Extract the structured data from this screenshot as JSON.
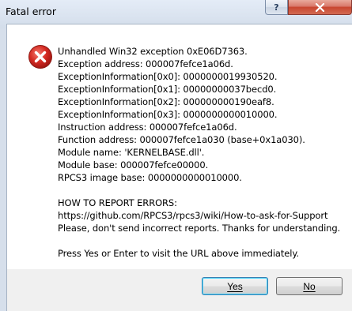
{
  "window": {
    "title": "Fatal error",
    "help_label": "?",
    "close_icon": "close-icon"
  },
  "dialog": {
    "icon": "error-icon",
    "lines": [
      "Unhandled Win32 exception 0xE06D7363.",
      "Exception address: 000007fefce1a06d.",
      "ExceptionInformation[0x0]: 0000000019930520.",
      "ExceptionInformation[0x1]: 00000000037becd0.",
      "ExceptionInformation[0x2]: 000000000190eaf8.",
      "ExceptionInformation[0x3]: 0000000000010000.",
      "Instruction address: 000007fefce1a06d.",
      "Function address: 000007fefce1a030 (base+0x1a030).",
      "Module name: 'KERNELBASE.dll'.",
      "Module base: 000007fefce00000.",
      "RPCS3 image base: 0000000000010000.",
      "",
      "HOW TO REPORT ERRORS:",
      "https://github.com/RPCS3/rpcs3/wiki/How-to-ask-for-Support",
      "Please, don't send incorrect reports. Thanks for understanding.",
      "",
      "Press Yes or Enter to visit the URL above immediately."
    ]
  },
  "buttons": {
    "yes": "Yes",
    "no": "No"
  },
  "colors": {
    "close_button": "#c8452f",
    "error_icon": "#d42a22",
    "default_button_border": "#3c7fb1"
  }
}
